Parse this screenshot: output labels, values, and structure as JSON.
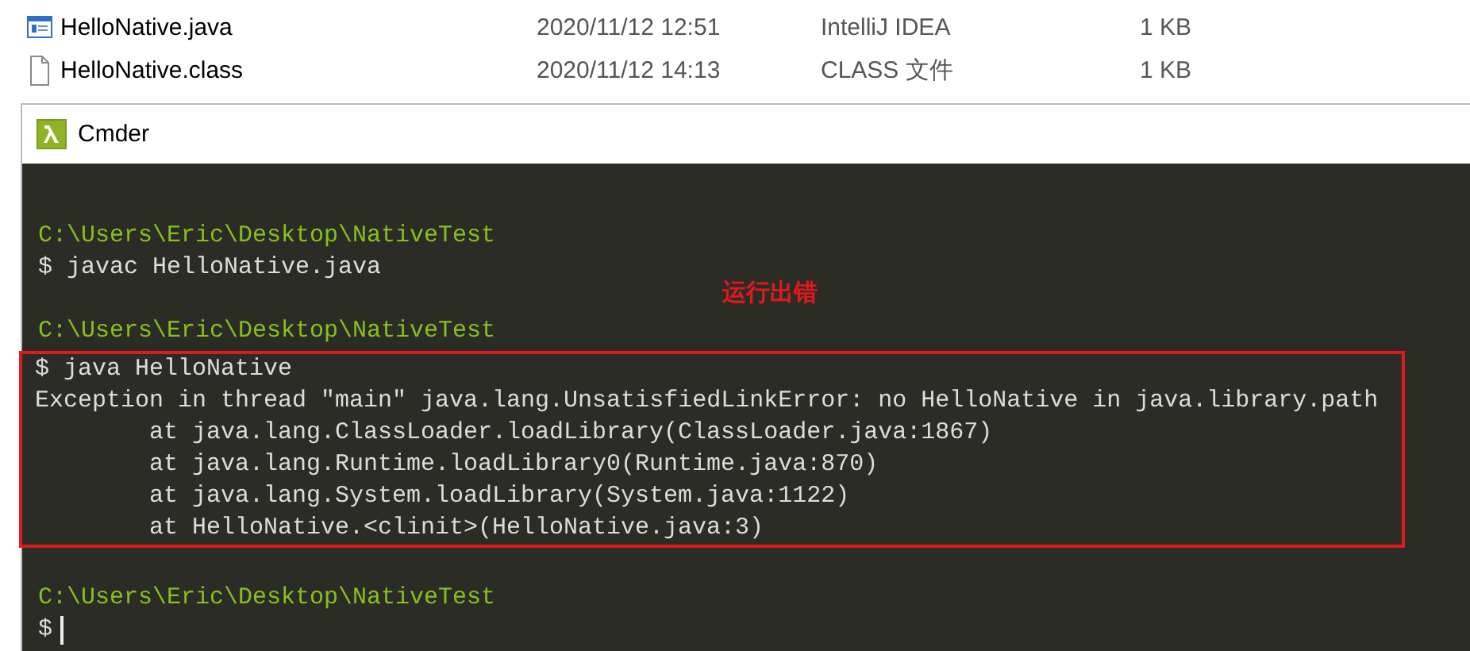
{
  "files": [
    {
      "kind": "java",
      "name": "HelloNative.java",
      "date": "2020/11/12 12:51",
      "type": "IntelliJ IDEA",
      "size": "1 KB"
    },
    {
      "kind": "file",
      "name": "HelloNative.class",
      "date": "2020/11/12 14:13",
      "type": "CLASS 文件",
      "size": "1 KB"
    }
  ],
  "window": {
    "title": "Cmder"
  },
  "terminal": {
    "groups": [
      {
        "highlighted": false,
        "lines": [
          {
            "kind": "blank"
          },
          {
            "kind": "path",
            "text": "C:\\Users\\Eric\\Desktop\\NativeTest"
          },
          {
            "kind": "command",
            "text": "$ javac HelloNative.java"
          },
          {
            "kind": "blank"
          },
          {
            "kind": "path",
            "text": "C:\\Users\\Eric\\Desktop\\NativeTest"
          }
        ]
      },
      {
        "highlighted": true,
        "lines": [
          {
            "kind": "command",
            "text": "$ java HelloNative"
          },
          {
            "kind": "output",
            "text": "Exception in thread \"main\" java.lang.UnsatisfiedLinkError: no HelloNative in java.library.path"
          },
          {
            "kind": "trace",
            "text": "at java.lang.ClassLoader.loadLibrary(ClassLoader.java:1867)"
          },
          {
            "kind": "trace",
            "text": "at java.lang.Runtime.loadLibrary0(Runtime.java:870)"
          },
          {
            "kind": "trace",
            "text": "at java.lang.System.loadLibrary(System.java:1122)"
          },
          {
            "kind": "trace",
            "text": "at HelloNative.<clinit>(HelloNative.java:3)"
          }
        ]
      },
      {
        "highlighted": false,
        "lines": [
          {
            "kind": "blank"
          },
          {
            "kind": "path",
            "text": "C:\\Users\\Eric\\Desktop\\NativeTest"
          },
          {
            "kind": "prompt",
            "text": "$"
          }
        ]
      }
    ],
    "annotation": "运行出错"
  }
}
